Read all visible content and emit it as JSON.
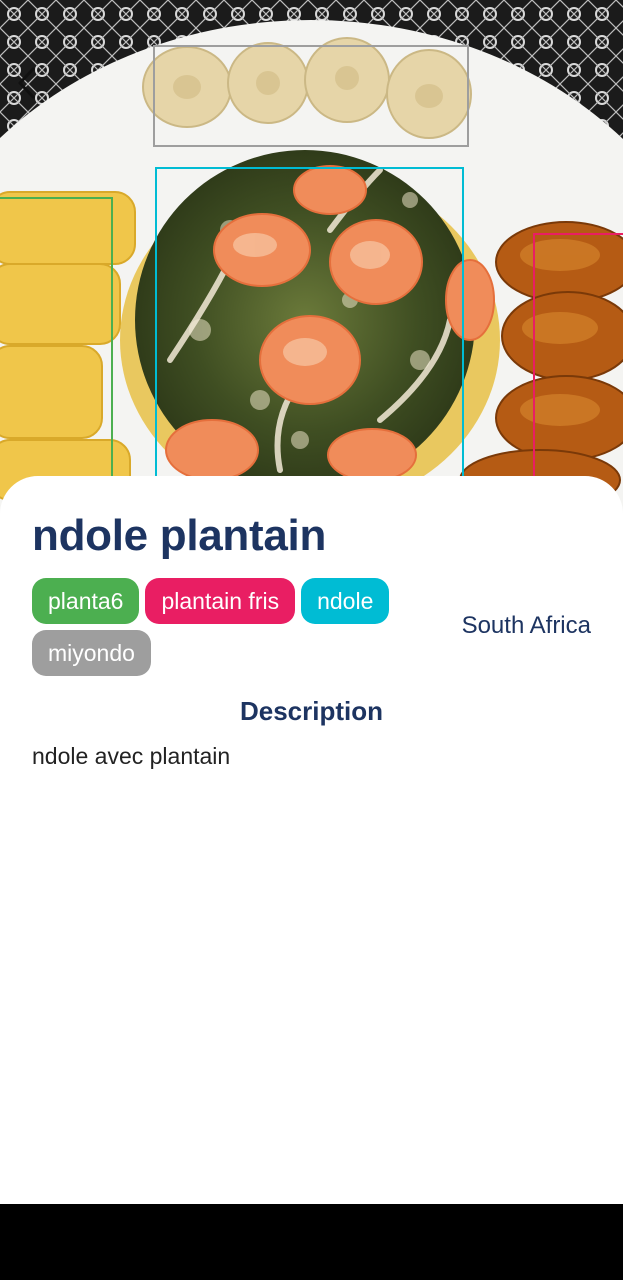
{
  "dish": {
    "title": "ndole plantain",
    "country": "South Africa",
    "description_heading": "Description",
    "description": "ndole avec plantain"
  },
  "tags": [
    {
      "label": "planta6",
      "color": "#4caf50"
    },
    {
      "label": "plantain fris",
      "color": "#e91e63"
    },
    {
      "label": "ndole",
      "color": "#00bcd4"
    },
    {
      "label": "miyondo",
      "color": "#9e9e9e"
    }
  ],
  "detection_box_colors": {
    "miyondo": "#9e9e9e",
    "ndole": "#00bcd4",
    "planta6": "#4caf50",
    "plantain_fris": "#e91e63"
  },
  "icons": {
    "back": "chevron-left-icon"
  },
  "colors": {
    "title": "#1d3461",
    "sheet": "#ffffff"
  }
}
